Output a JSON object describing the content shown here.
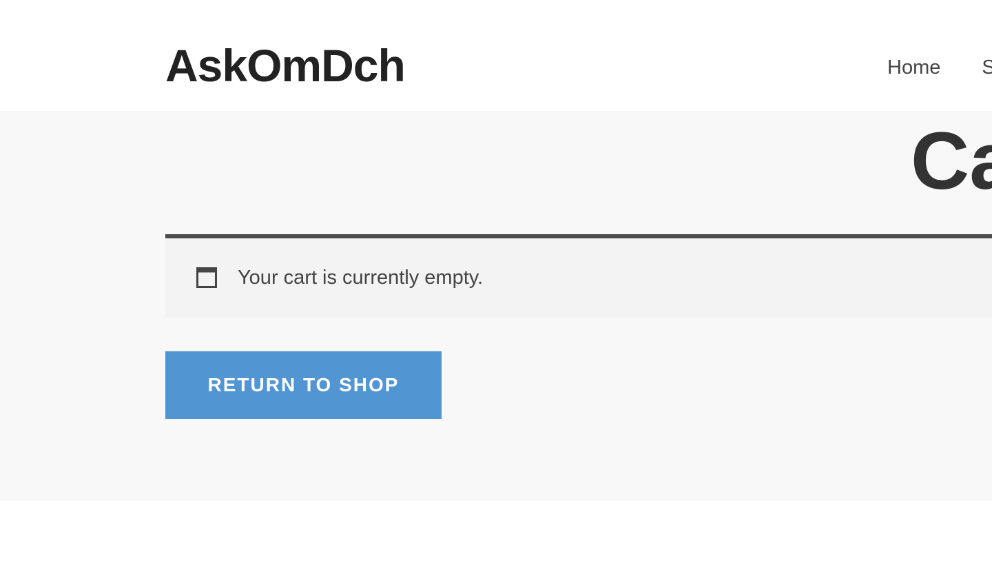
{
  "header": {
    "site_title": "AskOmDch",
    "nav": [
      {
        "label": "Home"
      },
      {
        "label": "S"
      }
    ]
  },
  "main": {
    "page_title": "Ca",
    "notice": {
      "icon": "window-icon",
      "text": "Your cart is currently empty."
    },
    "return_button_label": "RETURN TO SHOP"
  },
  "colors": {
    "button": "#5195d2",
    "notice_border": "#4c4c4c",
    "content_bg": "#f8f8f8"
  }
}
